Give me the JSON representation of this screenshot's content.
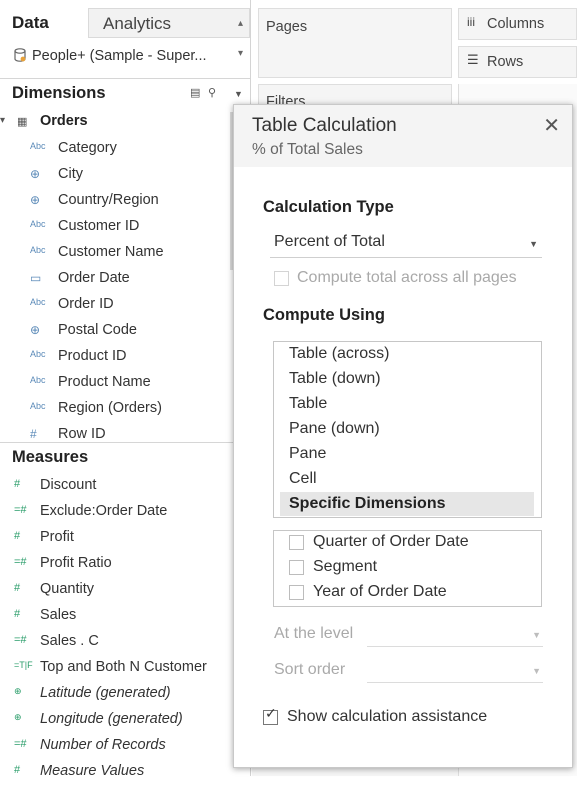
{
  "data_pane": {
    "tab_data": "Data",
    "tab_analytics": "Analytics",
    "datasource": "People+ (Sample - Super...",
    "dimensions_title": "Dimensions",
    "orders_folder": "Orders",
    "dimensions": [
      {
        "type": "Abc",
        "name": "Category"
      },
      {
        "type": "globe-icon",
        "name": "City"
      },
      {
        "type": "globe-icon",
        "name": "Country/Region"
      },
      {
        "type": "Abc",
        "name": "Customer ID"
      },
      {
        "type": "Abc",
        "name": "Customer Name"
      },
      {
        "type": "calendar-icon",
        "name": "Order Date"
      },
      {
        "type": "Abc",
        "name": "Order ID"
      },
      {
        "type": "globe-icon",
        "name": "Postal Code"
      },
      {
        "type": "Abc",
        "name": "Product ID"
      },
      {
        "type": "Abc",
        "name": "Product Name"
      },
      {
        "type": "Abc",
        "name": "Region (Orders)"
      },
      {
        "type": "#",
        "name": "Row ID"
      }
    ],
    "measures_title": "Measures",
    "measures": [
      {
        "type": "#",
        "name": "Discount"
      },
      {
        "type": "=#",
        "name": "Exclude:Order Date"
      },
      {
        "type": "#",
        "name": "Profit"
      },
      {
        "type": "=#",
        "name": "Profit Ratio"
      },
      {
        "type": "#",
        "name": "Quantity"
      },
      {
        "type": "#",
        "name": "Sales"
      },
      {
        "type": "=#",
        "name": "Sales . C"
      },
      {
        "type": "=T|F",
        "name": "Top and Both N Customer"
      },
      {
        "type": "globe-icon",
        "name": "Latitude (generated)"
      },
      {
        "type": "globe-icon",
        "name": "Longitude (generated)"
      },
      {
        "type": "=#",
        "name": "Number of Records"
      },
      {
        "type": "#",
        "name": "Measure Values"
      }
    ]
  },
  "shelves": {
    "pages": "Pages",
    "filters": "Filters",
    "columns": "Columns",
    "rows": "Rows"
  },
  "dialog": {
    "title": "Table Calculation",
    "subtitle": "% of Total Sales",
    "calc_type_title": "Calculation Type",
    "calc_type_value": "Percent of Total",
    "compute_all_pages": "Compute total across all pages",
    "compute_using_title": "Compute Using",
    "compute_using_options": [
      "Table (across)",
      "Table (down)",
      "Table",
      "Pane (down)",
      "Pane",
      "Cell",
      "Specific Dimensions"
    ],
    "selected_option": "Specific Dimensions",
    "dimension_checks": [
      "Quarter of Order Date",
      "Segment",
      "Year of Order Date"
    ],
    "at_the_level": "At the level",
    "sort_order": "Sort order",
    "show_assistance": "Show calculation assistance"
  }
}
